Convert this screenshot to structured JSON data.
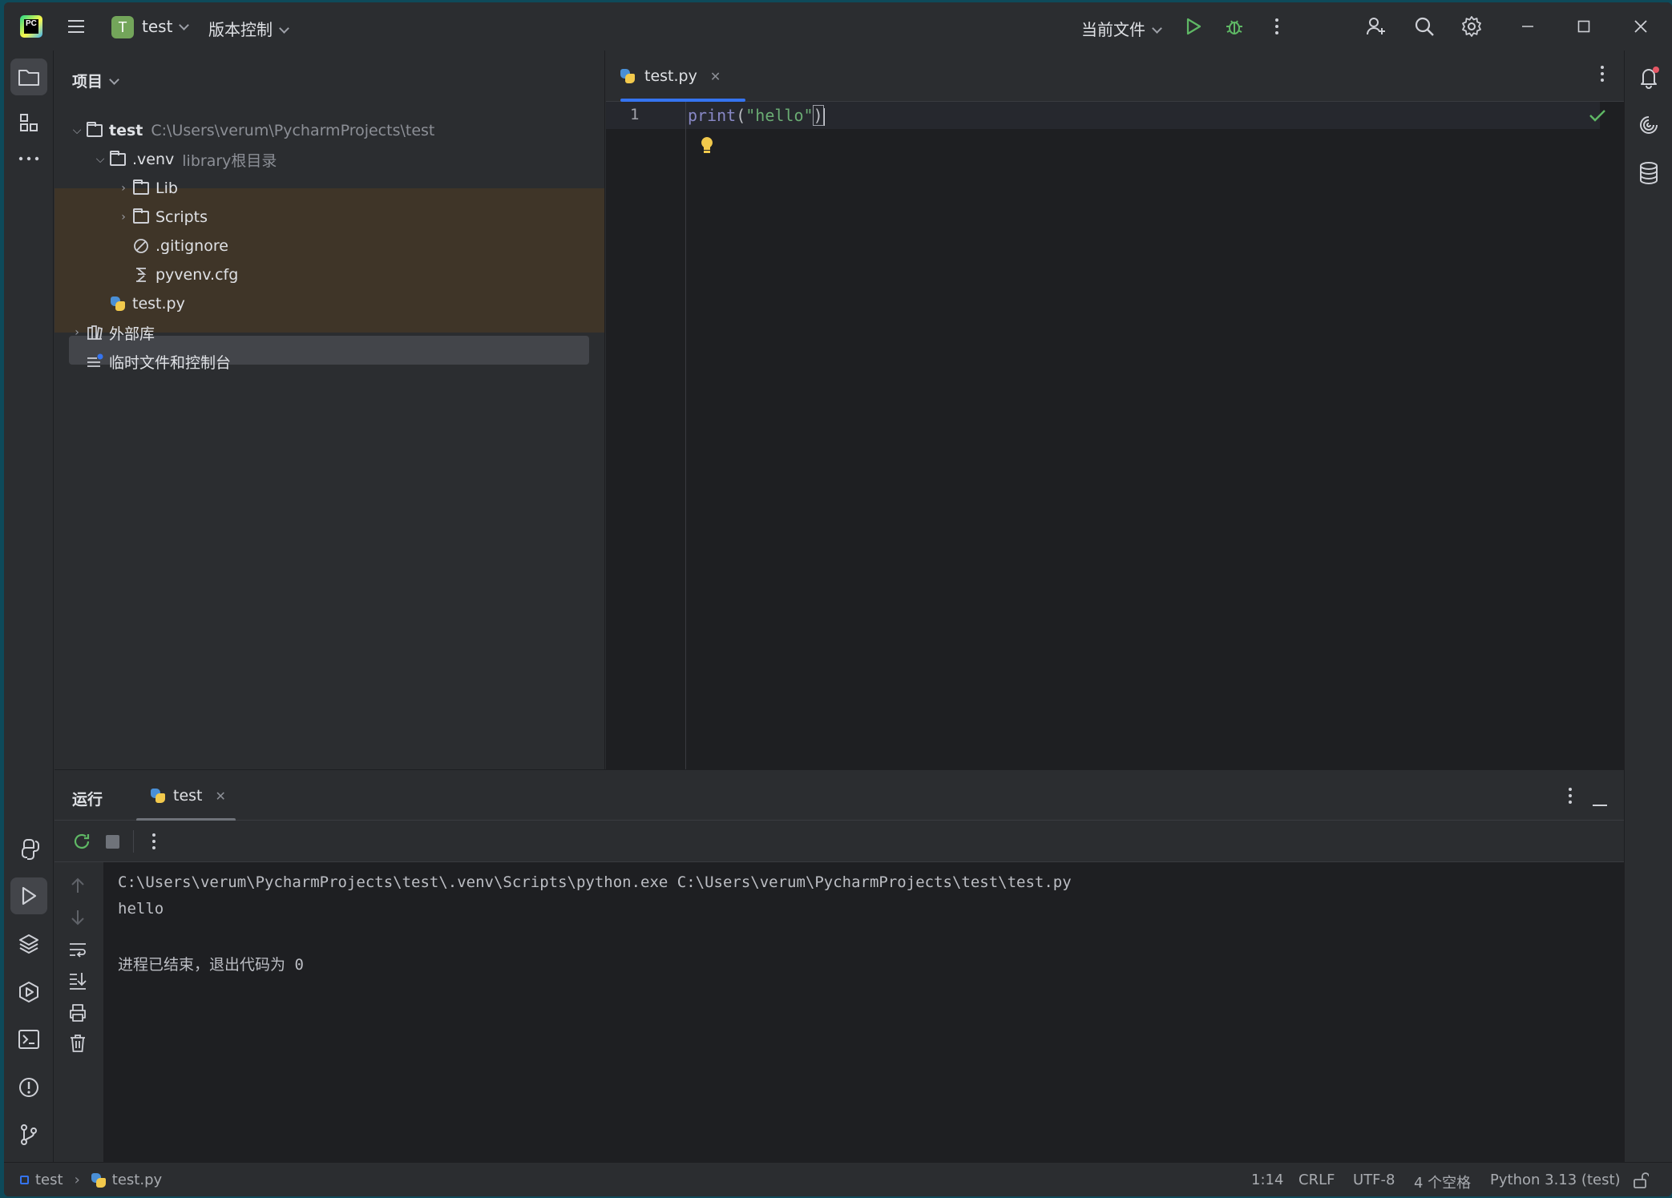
{
  "titlebar": {
    "project_badge": "T",
    "project_name": "test",
    "vcs_menu": "版本控制",
    "run_config": "当前文件"
  },
  "project_panel": {
    "title": "项目",
    "root": {
      "name": "test",
      "path": "C:\\Users\\verum\\PycharmProjects\\test"
    },
    "venv": {
      "name": ".venv",
      "note": "library根目录"
    },
    "items": [
      {
        "name": "Lib"
      },
      {
        "name": "Scripts"
      },
      {
        "name": ".gitignore"
      },
      {
        "name": "pyvenv.cfg"
      },
      {
        "name": "test.py"
      },
      {
        "name": "外部库"
      },
      {
        "name": "临时文件和控制台"
      }
    ]
  },
  "editor": {
    "tab_label": "test.py",
    "line_number": "1",
    "code_fn": "print",
    "code_open": "(",
    "code_str": "\"hello\"",
    "code_close": ")"
  },
  "run_panel": {
    "title": "运行",
    "tab_label": "test",
    "console_lines": [
      "C:\\Users\\verum\\PycharmProjects\\test\\.venv\\Scripts\\python.exe C:\\Users\\verum\\PycharmProjects\\test\\test.py",
      "hello",
      "进程已结束，退出代码为 0"
    ]
  },
  "statusbar": {
    "breadcrumb_project": "test",
    "breadcrumb_file": "test.py",
    "position": "1:14",
    "line_ending": "CRLF",
    "encoding": "UTF-8",
    "indent": "4 个空格",
    "interpreter": "Python 3.13 (test)"
  },
  "colors": {
    "accent": "#3574f0",
    "venv_highlight": "#3f3528",
    "run_green": "#5fb865",
    "string": "#6aab73",
    "keyword_fn": "#8888c6"
  }
}
